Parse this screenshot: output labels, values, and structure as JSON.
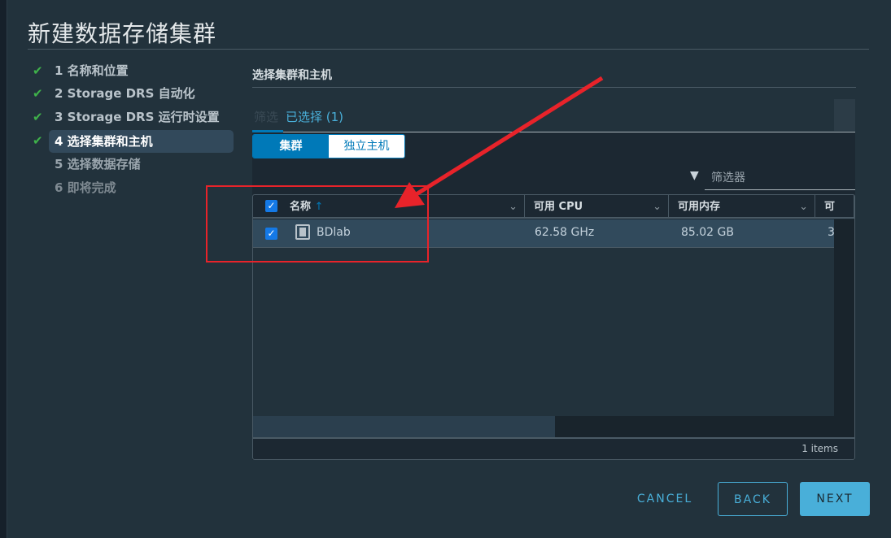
{
  "dialog": {
    "title": "新建数据存储集群"
  },
  "steps": [
    {
      "label": "1 名称和位置",
      "done": true
    },
    {
      "label": "2 Storage DRS 自动化",
      "done": true
    },
    {
      "label": "3 Storage DRS 运行时设置",
      "done": true
    },
    {
      "label": "4 选择集群和主机",
      "done": true,
      "active": true
    },
    {
      "label": "5 选择数据存储",
      "done": false
    },
    {
      "label": "6 即将完成",
      "done": false
    }
  ],
  "section": {
    "title": "选择集群和主机"
  },
  "tabs": [
    {
      "label": "筛选"
    },
    {
      "label": "已选择 (1)",
      "active": true
    }
  ],
  "toggle": {
    "options": [
      "集群",
      "独立主机"
    ],
    "selected": "集群"
  },
  "filter": {
    "placeholder": "筛选器",
    "icon": "filter-icon"
  },
  "grid": {
    "columns": [
      "名称",
      "可用 CPU",
      "可用内存",
      "可"
    ],
    "sort": "名称 ascending",
    "rows": [
      {
        "checked": true,
        "icon": "cluster-icon",
        "name": "BDlab",
        "cpu": "62.58 GHz",
        "memory": "85.02 GB",
        "more": "3"
      }
    ],
    "footer": "1 items"
  },
  "buttons": {
    "cancel": "CANCEL",
    "back": "BACK",
    "next": "NEXT"
  },
  "colors": {
    "accent": "#49afd9",
    "check": "#3fb24a",
    "annotation": "#e8232a"
  }
}
